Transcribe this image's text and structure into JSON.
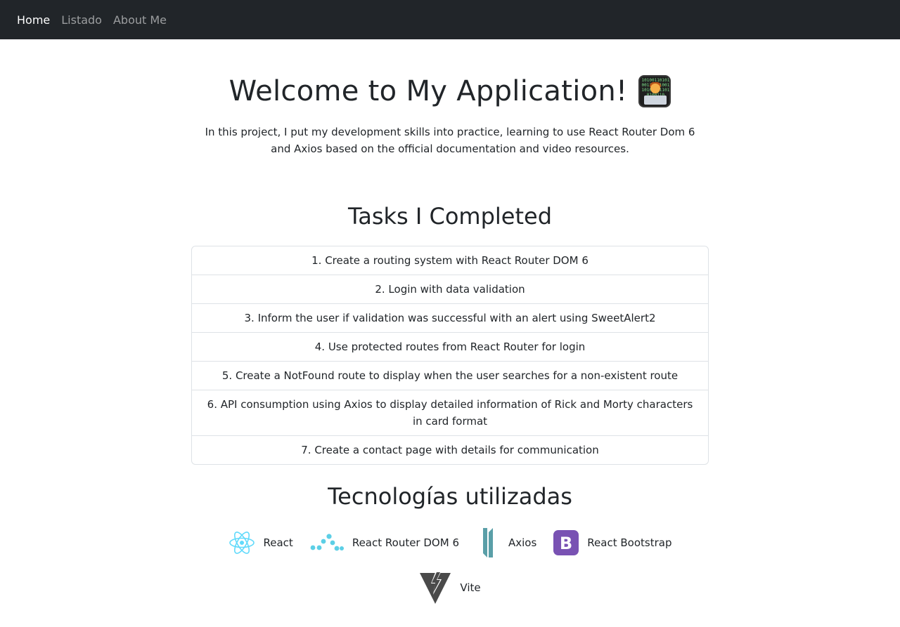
{
  "nav": {
    "links": [
      {
        "label": "Home",
        "active": true
      },
      {
        "label": "Listado",
        "active": false
      },
      {
        "label": "About Me",
        "active": false
      }
    ]
  },
  "hero": {
    "title": "Welcome to My Application!",
    "emoji": "technologist-icon",
    "intro": "In this project, I put my development skills into practice, learning to use React Router Dom 6 and Axios based on the official documentation and video resources."
  },
  "tasks": {
    "title": "Tasks I Completed",
    "items": [
      "1. Create a routing system with React Router DOM 6",
      "2. Login with data validation",
      "3. Inform the user if validation was successful with an alert using SweetAlert2",
      "4. Use protected routes from React Router for login",
      "5. Create a NotFound route to display when the user searches for a non-existent route",
      "6. API consumption using Axios to display detailed information of Rick and Morty characters in card format",
      "7. Create a contact page with details for communication"
    ]
  },
  "technologies": {
    "title": "Tecnologías utilizadas",
    "items": [
      {
        "label": "React",
        "icon": "react-icon",
        "color": "#61dafb"
      },
      {
        "label": "React Router DOM 6",
        "icon": "react-router-icon",
        "color": "#5ccfe6"
      },
      {
        "label": "Axios",
        "icon": "axios-icon",
        "color": "#5a9fa8"
      },
      {
        "label": "React Bootstrap",
        "icon": "bootstrap-icon",
        "color": "#7952b3"
      },
      {
        "label": "Vite",
        "icon": "vite-icon",
        "color": "#4a4a4a"
      }
    ]
  },
  "colors": {
    "navbar_bg": "#212529",
    "text": "#212529",
    "border": "#dee2e6"
  }
}
